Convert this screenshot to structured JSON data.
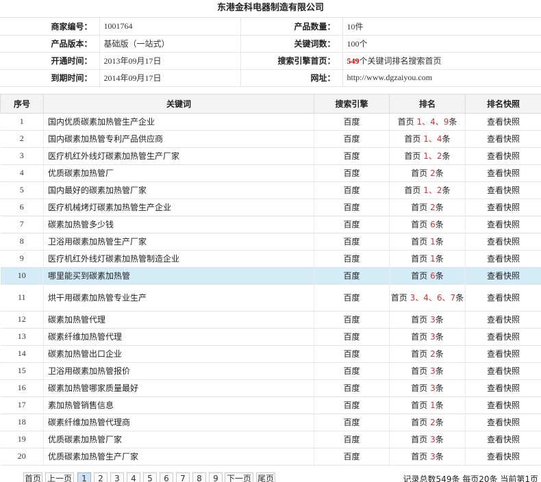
{
  "company": "东港金科电器制造有限公司",
  "info": [
    {
      "l1": "商家编号：",
      "v1": "1001764",
      "l2": "产品数量：",
      "v2": "10件"
    },
    {
      "l1": "产品版本：",
      "v1": "基础版（一站式）",
      "l2": "关键词数：",
      "v2": "100个"
    },
    {
      "l1": "开通时间：",
      "v1": "2013年09月17日",
      "l2": "搜索引擎首页：",
      "v2_num": "549",
      "v2": "个关键词排名搜索首页"
    },
    {
      "l1": "到期时间：",
      "v1": "2014年09月17日",
      "l2": "网址：",
      "v2": "http://www.dgzaiyou.com"
    }
  ],
  "table": {
    "headers": [
      "序号",
      "关键词",
      "搜索引擎",
      "排名",
      "排名快照"
    ],
    "rows": [
      {
        "idx": "1",
        "kw": "国内优质碳素加热管生产企业",
        "engine": "百度",
        "pre": "首页",
        "nums": "1、4、9",
        "suf": "条",
        "snap": "查看快照"
      },
      {
        "idx": "2",
        "kw": "国内碳素加热管专利产品供应商",
        "engine": "百度",
        "pre": "首页",
        "nums": "1、4",
        "suf": "条",
        "snap": "查看快照"
      },
      {
        "idx": "3",
        "kw": "医疗机红外线灯碳素加热管生产厂家",
        "engine": "百度",
        "pre": "首页",
        "nums": "1、2",
        "suf": "条",
        "snap": "查看快照"
      },
      {
        "idx": "4",
        "kw": "优质碳素加热管厂",
        "engine": "百度",
        "pre": "首页",
        "nums": "2",
        "suf": "条",
        "snap": "查看快照"
      },
      {
        "idx": "5",
        "kw": "国内最好的碳素加热管厂家",
        "engine": "百度",
        "pre": "首页",
        "nums": "1、2",
        "suf": "条",
        "snap": "查看快照"
      },
      {
        "idx": "6",
        "kw": "医疗机械烤灯碳素加热管生产企业",
        "engine": "百度",
        "pre": "首页",
        "nums": "2",
        "suf": "条",
        "snap": "查看快照"
      },
      {
        "idx": "7",
        "kw": "碳素加热管多少钱",
        "engine": "百度",
        "pre": "首页",
        "nums": "6",
        "suf": "条",
        "snap": "查看快照"
      },
      {
        "idx": "8",
        "kw": "卫浴用碳素加热管生产厂家",
        "engine": "百度",
        "pre": "首页",
        "nums": "1",
        "suf": "条",
        "snap": "查看快照"
      },
      {
        "idx": "9",
        "kw": "医疗机红外线灯碳素加热管制造企业",
        "engine": "百度",
        "pre": "首页",
        "nums": "1",
        "suf": "条",
        "snap": "查看快照"
      },
      {
        "idx": "10",
        "kw": "哪里能买到碳素加热管",
        "engine": "百度",
        "pre": "首页",
        "nums": "6",
        "suf": "条",
        "snap": "查看快照",
        "hl": true
      },
      {
        "idx": "11",
        "kw": "烘干用碳素加热管专业生产",
        "engine": "百度",
        "pre": "首页",
        "nums": "3、4、6、7",
        "suf": "条",
        "snap": "查看快照",
        "tall": true
      },
      {
        "idx": "12",
        "kw": "碳素加热管代理",
        "engine": "百度",
        "pre": "首页",
        "nums": "3",
        "suf": "条",
        "snap": "查看快照"
      },
      {
        "idx": "13",
        "kw": "碳素纤维加热管代理",
        "engine": "百度",
        "pre": "首页",
        "nums": "3",
        "suf": "条",
        "snap": "查看快照"
      },
      {
        "idx": "14",
        "kw": "碳素加热管出口企业",
        "engine": "百度",
        "pre": "首页",
        "nums": "2",
        "suf": "条",
        "snap": "查看快照"
      },
      {
        "idx": "15",
        "kw": "卫浴用碳素加热管报价",
        "engine": "百度",
        "pre": "首页",
        "nums": "3",
        "suf": "条",
        "snap": "查看快照"
      },
      {
        "idx": "16",
        "kw": "碳素加热管哪家质量最好",
        "engine": "百度",
        "pre": "首页",
        "nums": "3",
        "suf": "条",
        "snap": "查看快照"
      },
      {
        "idx": "17",
        "kw": "素加热管销售信息",
        "engine": "百度",
        "pre": "首页",
        "nums": "1",
        "suf": "条",
        "snap": "查看快照"
      },
      {
        "idx": "18",
        "kw": "碳素纤维加热管代理商",
        "engine": "百度",
        "pre": "首页",
        "nums": "2",
        "suf": "条",
        "snap": "查看快照"
      },
      {
        "idx": "19",
        "kw": "优质碳素加热管厂家",
        "engine": "百度",
        "pre": "首页",
        "nums": "3",
        "suf": "条",
        "snap": "查看快照"
      },
      {
        "idx": "20",
        "kw": "优质碳素加热管生产厂家",
        "engine": "百度",
        "pre": "首页",
        "nums": "3",
        "suf": "条",
        "snap": "查看快照"
      }
    ]
  },
  "pager": {
    "first": "首页",
    "prev": "上一页",
    "pages": [
      "1",
      "2",
      "3",
      "4",
      "5",
      "6",
      "7",
      "8",
      "9"
    ],
    "current": "1",
    "next": "下一页",
    "last": "尾页",
    "record": "记录总数549条 每页20条 当前第1页"
  }
}
